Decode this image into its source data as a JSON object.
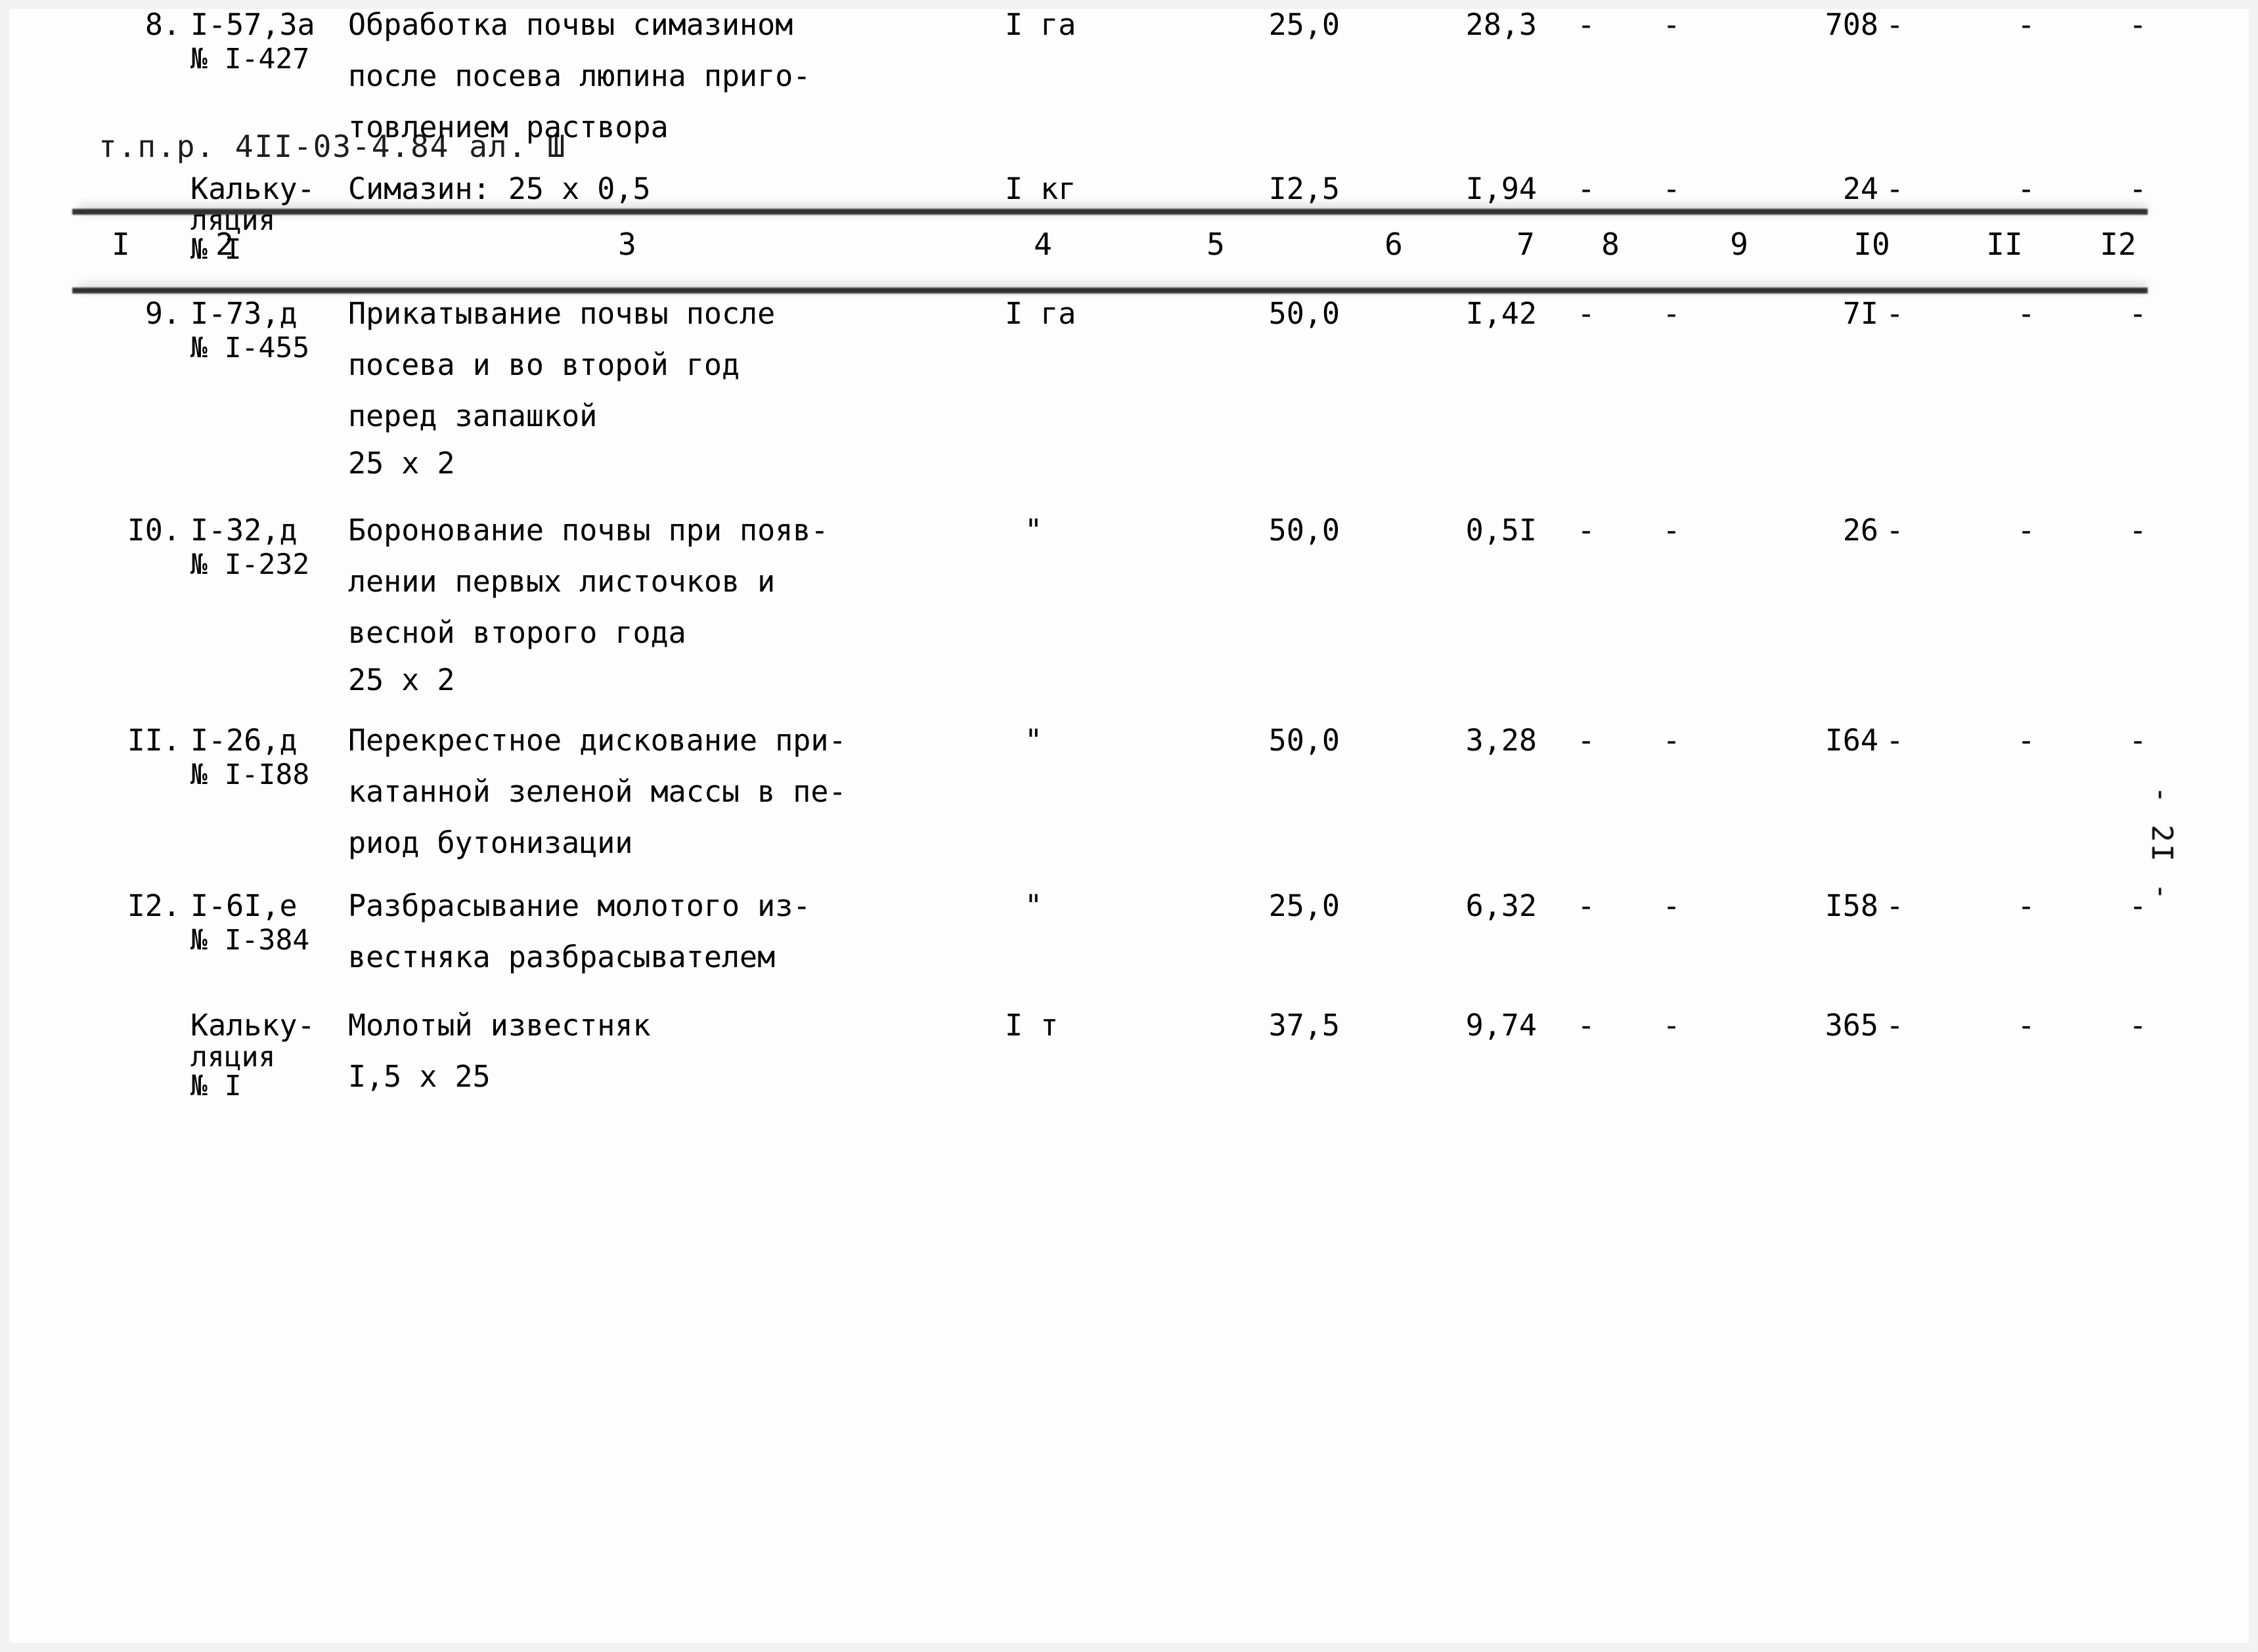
{
  "document": {
    "header": "т.п.р. 4II-03-4.84 ал. Ш",
    "page_number": "- 2I -"
  },
  "table": {
    "column_numbers": [
      "I",
      "2",
      "3",
      "4",
      "5",
      "6",
      "7",
      "8",
      "9",
      "I0",
      "II",
      "I2"
    ],
    "rows": [
      {
        "num": "8.",
        "code_line1": "I-57,3а",
        "code_line2": "№ I-427",
        "desc_lines": [
          "Обработка почвы симазином",
          "после посева люпина приго-",
          "товлением раствора"
        ],
        "unit": "I га",
        "c5": "25,0",
        "c6": "28,3",
        "c7": "-",
        "c8": "-",
        "c9": "708",
        "c10": "-",
        "c11": "-",
        "c12": "-"
      },
      {
        "num": "",
        "code_line1": "Кальку-",
        "code_line2": "ляция",
        "code_line3": "№ I",
        "desc_lines": [
          "Симазин: 25 x 0,5"
        ],
        "unit": "I кг",
        "c5": "I2,5",
        "c6": "I,94",
        "c7": "-",
        "c8": "-",
        "c9": "24",
        "c10": "-",
        "c11": "-",
        "c12": "-"
      },
      {
        "num": "9.",
        "code_line1": "I-73,д",
        "code_line2": "№ I-455",
        "desc_lines": [
          "Прикатывание почвы после",
          "посева и во второй год",
          "перед запашкой",
          "25 x 2"
        ],
        "unit": "I га",
        "c5": "50,0",
        "c6": "I,42",
        "c7": "-",
        "c8": "-",
        "c9": "7I",
        "c10": "-",
        "c11": "-",
        "c12": "-"
      },
      {
        "num": "I0.",
        "code_line1": "I-32,д",
        "code_line2": "№ I-232",
        "desc_lines": [
          "Боронование почвы при появ-",
          "лении первых листочков и",
          "весной второго года",
          "25 x 2"
        ],
        "unit": "\"",
        "c5": "50,0",
        "c6": "0,5I",
        "c7": "-",
        "c8": "-",
        "c9": "26",
        "c10": "-",
        "c11": "-",
        "c12": "-"
      },
      {
        "num": "II.",
        "code_line1": "I-26,д",
        "code_line2": "№ I-I88",
        "desc_lines": [
          "Перекрестное дискование при-",
          "катанной зеленой массы в пе-",
          "риод бутонизации"
        ],
        "unit": "\"",
        "c5": "50,0",
        "c6": "3,28",
        "c7": "-",
        "c8": "-",
        "c9": "I64",
        "c10": "-",
        "c11": "-",
        "c12": "-"
      },
      {
        "num": "I2.",
        "code_line1": "I-6I,е",
        "code_line2": "№ I-384",
        "desc_lines": [
          "Разбрасывание молотого из-",
          "вестняка разбрасывателем"
        ],
        "unit": "\"",
        "c5": "25,0",
        "c6": "6,32",
        "c7": "-",
        "c8": "-",
        "c9": "I58",
        "c10": "-",
        "c11": "-",
        "c12": "-"
      },
      {
        "num": "",
        "code_line1": "Кальку-",
        "code_line2": "ляция",
        "code_line3": "№ I",
        "desc_lines": [
          "Молотый известняк",
          "I,5 x 25"
        ],
        "unit": "I т",
        "c5": "37,5",
        "c6": "9,74",
        "c7": "-",
        "c8": "-",
        "c9": "365",
        "c10": "-",
        "c11": "-",
        "c12": "-"
      }
    ]
  }
}
